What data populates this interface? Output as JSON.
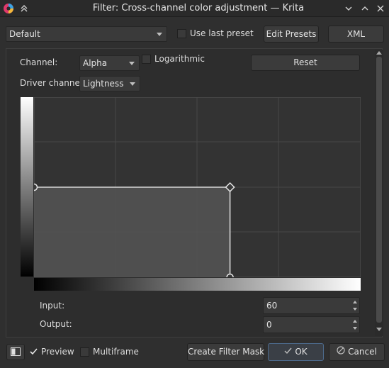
{
  "window": {
    "title": "Filter: Cross-channel color adjustment — Krita"
  },
  "icons": {
    "app": "krita-logo-icon",
    "titlebar_menu": "chevrons-up-icon",
    "minimize": "chevron-down-icon",
    "maximize": "chevron-up-icon",
    "close": "close-icon",
    "preview_toggle": "preview-rect-icon",
    "ok": "check-icon",
    "cancel": "cancel-circle-icon"
  },
  "presets": {
    "selected": "Default",
    "use_last_preset_label": "Use last preset",
    "edit_presets_label": "Edit Presets",
    "xml_label": "XML"
  },
  "controls": {
    "channel_label": "Channel:",
    "channel_value": "Alpha",
    "logarithmic_label": "Logarithmic",
    "reset_label": "Reset",
    "driver_label": "Driver channel",
    "driver_value": "Lightness"
  },
  "curve": {
    "points": [
      [
        0,
        0.5
      ],
      [
        0.6,
        0.5
      ],
      [
        0.6,
        0.0
      ]
    ]
  },
  "values": {
    "input_label": "Input:",
    "input_value": "60",
    "output_label": "Output:",
    "output_value": "0"
  },
  "footer": {
    "preview_label": "Preview",
    "multiframe_label": "Multiframe",
    "create_mask_label": "Create Filter Mask",
    "ok_label": "OK",
    "cancel_label": "Cancel"
  },
  "colors": {
    "background": "#2f2f2f",
    "curve_bg": "#333333",
    "curve_line": "#d8d8d8",
    "accent": "#5a6e86"
  }
}
